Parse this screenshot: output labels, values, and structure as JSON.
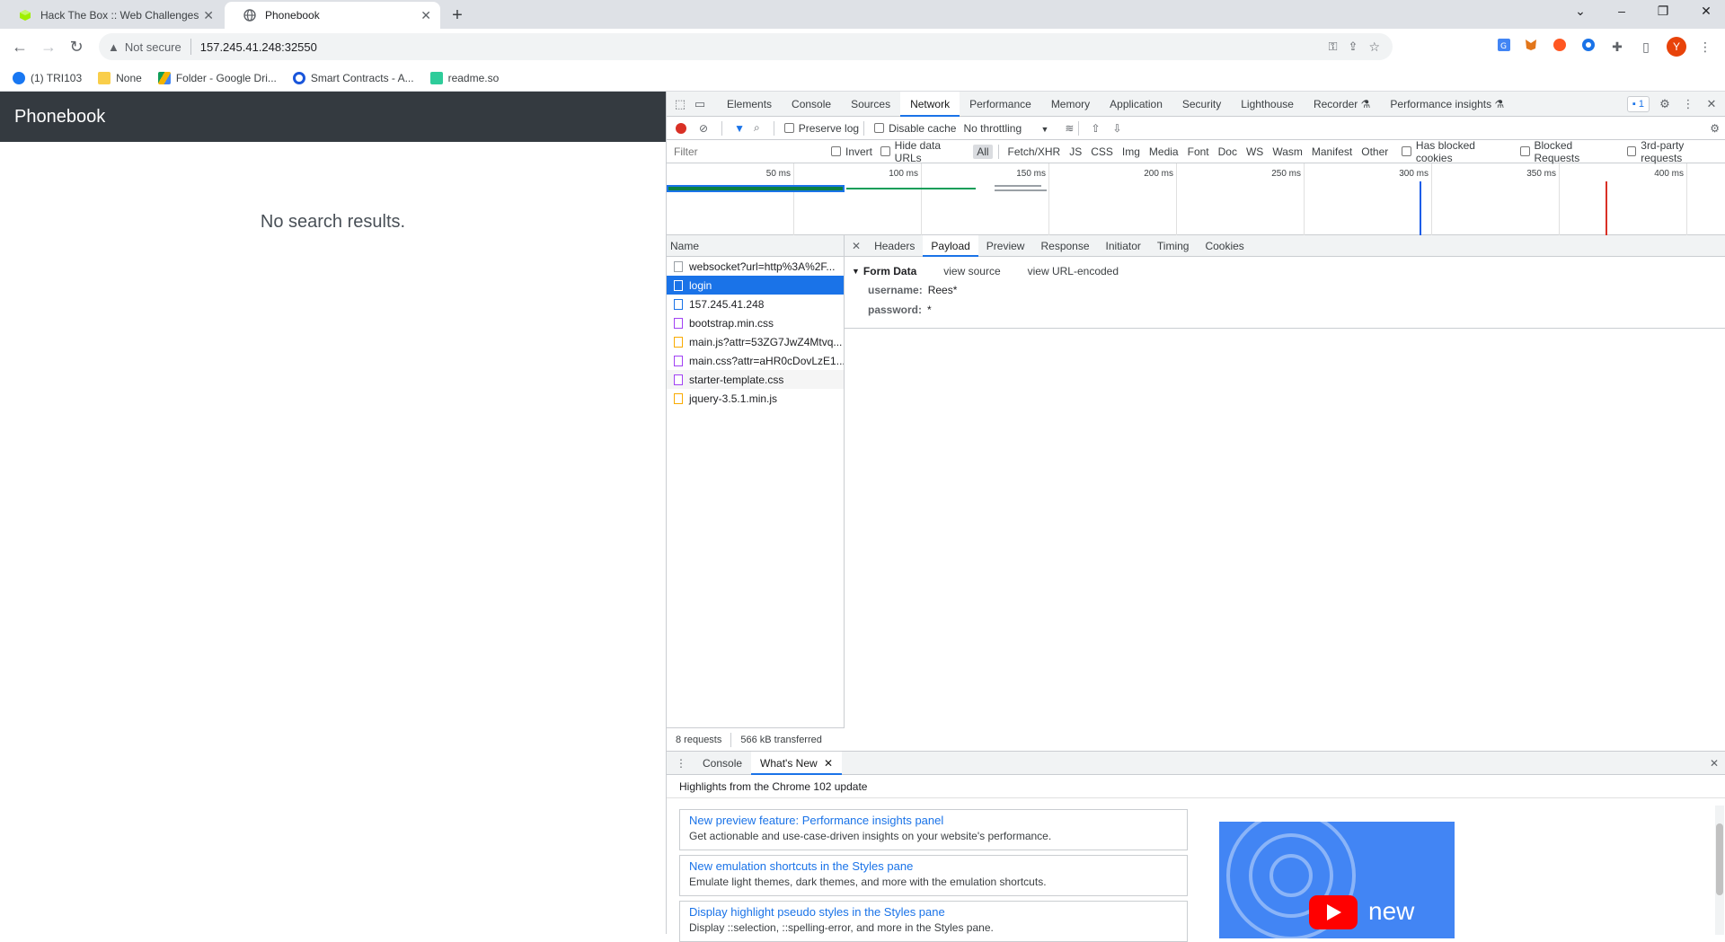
{
  "browser": {
    "tabs": [
      {
        "title": "Hack The Box :: Web Challenges",
        "active": false
      },
      {
        "title": "Phonebook",
        "active": true
      }
    ],
    "new_tab": "+",
    "security_label": "Not secure",
    "url": "157.245.41.248:32550",
    "profile_initial": "Y",
    "bookmarks": [
      "(1) TRI103",
      "None",
      "Folder - Google Dri...",
      "Smart Contracts - A...",
      "readme.so"
    ]
  },
  "page": {
    "brand": "Phonebook",
    "message": "No search results."
  },
  "devtools": {
    "tabs": [
      "Elements",
      "Console",
      "Sources",
      "Network",
      "Performance",
      "Memory",
      "Application",
      "Security",
      "Lighthouse",
      "Recorder",
      "Performance insights"
    ],
    "active_tab": "Network",
    "issues_count": "1",
    "toolbar": {
      "preserve_log": "Preserve log",
      "disable_cache": "Disable cache",
      "throttling": "No throttling"
    },
    "filter": {
      "placeholder": "Filter",
      "invert": "Invert",
      "hide_data_urls": "Hide data URLs",
      "types": [
        "All",
        "Fetch/XHR",
        "JS",
        "CSS",
        "Img",
        "Media",
        "Font",
        "Doc",
        "WS",
        "Wasm",
        "Manifest",
        "Other"
      ],
      "has_blocked_cookies": "Has blocked cookies",
      "blocked_requests": "Blocked Requests",
      "third_party": "3rd-party requests"
    },
    "overview_ticks": [
      "50 ms",
      "100 ms",
      "150 ms",
      "200 ms",
      "250 ms",
      "300 ms",
      "350 ms",
      "400 ms"
    ],
    "requests_header": "Name",
    "requests": [
      {
        "name": "websocket?url=http%3A%2F...",
        "kind": "doc"
      },
      {
        "name": "login",
        "kind": "doc",
        "selected": true
      },
      {
        "name": "157.245.41.248",
        "kind": "doc"
      },
      {
        "name": "bootstrap.min.css",
        "kind": "css"
      },
      {
        "name": "main.js?attr=53ZG7JwZ4Mtvq...",
        "kind": "js"
      },
      {
        "name": "main.css?attr=aHR0cDovLzE1...",
        "kind": "css"
      },
      {
        "name": "starter-template.css",
        "kind": "css"
      },
      {
        "name": "jquery-3.5.1.min.js",
        "kind": "js"
      }
    ],
    "summary": {
      "requests": "8 requests",
      "transferred": "566 kB transferred"
    },
    "detail_tabs": [
      "Headers",
      "Payload",
      "Preview",
      "Response",
      "Initiator",
      "Timing",
      "Cookies"
    ],
    "active_detail_tab": "Payload",
    "form_data": {
      "title": "Form Data",
      "view_source": "view source",
      "view_url_encoded": "view URL-encoded",
      "fields": [
        {
          "key": "username:",
          "value": "Rees*"
        },
        {
          "key": "password:",
          "value": "*"
        }
      ]
    },
    "drawer": {
      "tabs": [
        "Console",
        "What's New"
      ],
      "active": "What's New",
      "highlight_title": "Highlights from the Chrome 102 update",
      "items": [
        {
          "title": "New preview feature: Performance insights panel",
          "desc": "Get actionable and use-case-driven insights on your website's performance."
        },
        {
          "title": "New emulation shortcuts in the Styles pane",
          "desc": "Emulate light themes, dark themes, and more with the emulation shortcuts."
        },
        {
          "title": "Display highlight pseudo styles in the Styles pane",
          "desc": "Display ::selection, ::spelling-error, and more in the Styles pane."
        }
      ],
      "video_caption": "new"
    }
  }
}
